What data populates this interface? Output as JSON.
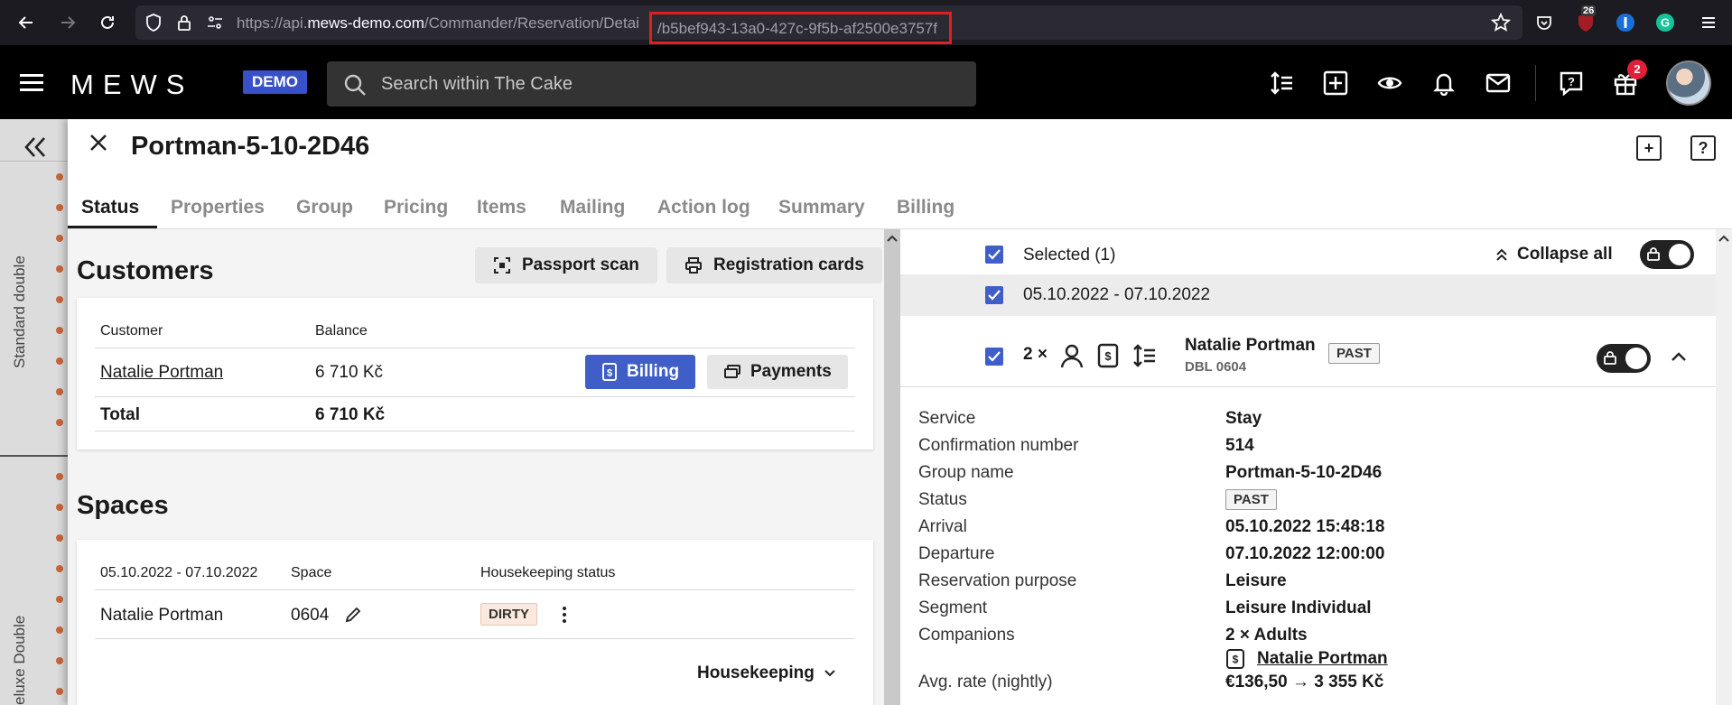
{
  "browser": {
    "url_prefix": "https://api.",
    "url_domain": "mews-demo.com",
    "url_path": "/Commander/Reservation/Detai",
    "url_id": "/b5bef943-13a0-427c-9f5b-af2500e3757f",
    "ext_badge_count": "26"
  },
  "header": {
    "logo": "MEWS",
    "demo_label": "DEMO",
    "search_placeholder": "Search within The Cake",
    "gift_badge": "2"
  },
  "background": {
    "room_type_1": "Standard double",
    "room_type_2": "eluxe Double"
  },
  "panel": {
    "title": "Portman-5-10-2D46",
    "tabs": [
      {
        "label": "Status"
      },
      {
        "label": "Properties"
      },
      {
        "label": "Group"
      },
      {
        "label": "Pricing"
      },
      {
        "label": "Items"
      },
      {
        "label": "Mailing"
      },
      {
        "label": "Action log"
      },
      {
        "label": "Summary"
      },
      {
        "label": "Billing"
      }
    ]
  },
  "customers": {
    "title": "Customers",
    "passport_scan": "Passport scan",
    "registration_cards": "Registration cards",
    "col_customer": "Customer",
    "col_balance": "Balance",
    "row_name": "Natalie Portman",
    "row_balance": "6 710 Kč",
    "billing_btn": "Billing",
    "payments_btn": "Payments",
    "total_label": "Total",
    "total_value": "6 710 Kč"
  },
  "spaces": {
    "title": "Spaces",
    "col_dates": "05.10.2022 - 07.10.2022",
    "col_space": "Space",
    "col_hk": "Housekeeping status",
    "row_name": "Natalie Portman",
    "row_space": "0604",
    "row_status": "DIRTY",
    "housekeeping_link": "Housekeeping"
  },
  "right": {
    "selected_label": "Selected (1)",
    "collapse_all": "Collapse all",
    "date_range": "05.10.2022 - 07.10.2022",
    "count": "2 ×",
    "guest_name": "Natalie Portman",
    "guest_room": "DBL 0604",
    "guest_status": "PAST",
    "details": {
      "service_label": "Service",
      "service": "Stay",
      "conf_label": "Confirmation number",
      "conf": "514",
      "group_label": "Group name",
      "group": "Portman-5-10-2D46",
      "status_label": "Status",
      "status": "PAST",
      "arrival_label": "Arrival",
      "arrival": "05.10.2022 15:48:18",
      "departure_label": "Departure",
      "departure": "07.10.2022 12:00:00",
      "purpose_label": "Reservation purpose",
      "purpose": "Leisure",
      "segment_label": "Segment",
      "segment": "Leisure Individual",
      "companions_label": "Companions",
      "companions": "2 × Adults",
      "companion_name": "Natalie Portman",
      "avg_label": "Avg. rate (nightly)",
      "avg": "€136,50 → 3 355 Kč"
    }
  }
}
